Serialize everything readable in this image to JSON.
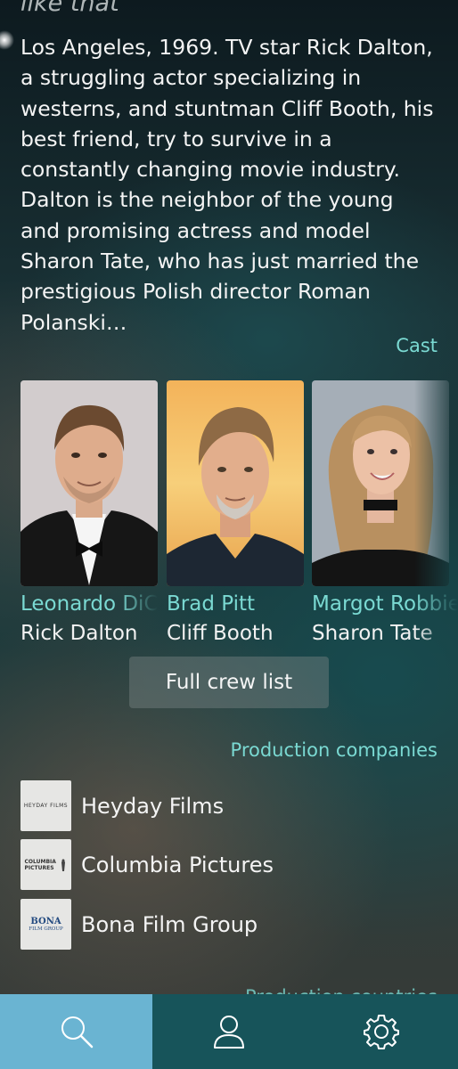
{
  "tagline": "like that",
  "overview": "Los Angeles, 1969. TV star Rick Dalton, a struggling actor specializing in westerns, and stuntman Cliff Booth, his best friend, try to survive in a constantly changing movie industry. Dalton is the neighbor of the young and promising actress and model Sharon Tate, who has just married the prestigious Polish director Roman Polanski…",
  "cast_header": "Cast",
  "cast": [
    {
      "name": "Leonardo DiCaprio",
      "role": "Rick Dalton"
    },
    {
      "name": "Brad Pitt",
      "role": "Cliff Booth"
    },
    {
      "name": "Margot Robbie",
      "role": "Sharon Tate"
    }
  ],
  "crew_button": "Full crew list",
  "production_header": "Production companies",
  "companies": [
    {
      "name": "Heyday Films",
      "logo_text": "HEYDAY FILMS"
    },
    {
      "name": "Columbia Pictures",
      "logo_text": "COLUMBIA PICTURES"
    },
    {
      "name": "Bona Film Group",
      "logo_text_top": "BONA",
      "logo_text_bottom": "FILM GROUP"
    }
  ],
  "countries_header": "Production countries",
  "nav": [
    {
      "icon": "search-icon",
      "active": true
    },
    {
      "icon": "person-icon",
      "active": false
    },
    {
      "icon": "gear-icon",
      "active": false
    }
  ],
  "colors": {
    "accent": "#7ad9d2",
    "active_tab": "#6ab4d2",
    "bottom_bar": "#17545a"
  }
}
